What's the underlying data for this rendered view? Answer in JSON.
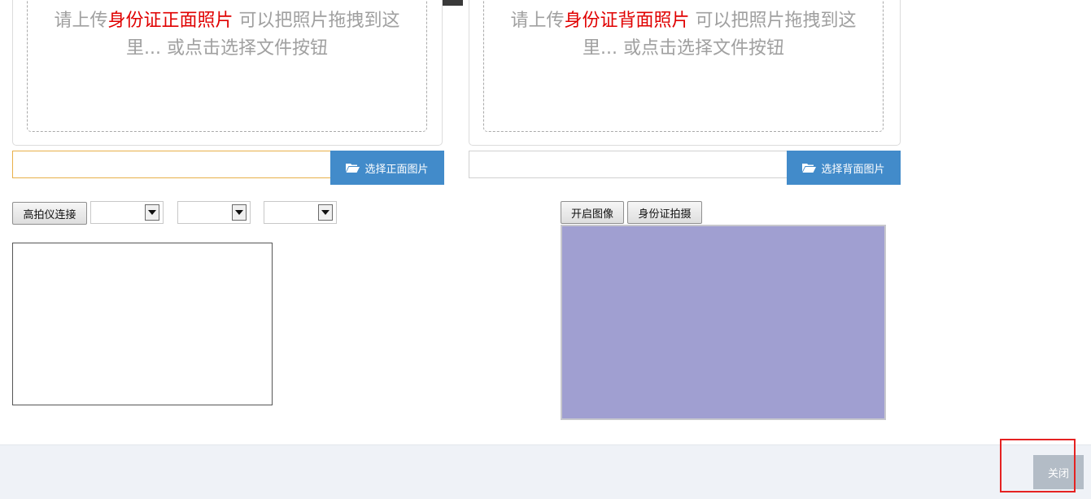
{
  "front_upload": {
    "drop_prefix": "请上传",
    "drop_highlight": "身份证正面照片",
    "drop_suffix": " 可以把照片拖拽到这里... 或点击选择文件按钮",
    "path_value": "",
    "button_label": "选择正面图片"
  },
  "back_upload": {
    "drop_prefix": "请上传",
    "drop_highlight": "身份证背面照片",
    "drop_suffix": " 可以把照片拖拽到这里... 或点击选择文件按钮",
    "path_value": "",
    "button_label": "选择背面图片"
  },
  "scanner": {
    "connect_label": "高拍仪连接",
    "select1_value": "",
    "select2_value": "",
    "select3_value": ""
  },
  "camera": {
    "open_label": "开启图像",
    "capture_label": "身份证拍摄"
  },
  "footer": {
    "close_label": "关闭"
  },
  "colors": {
    "accent_blue": "#428bca",
    "highlight_red": "#e00000",
    "camera_bg": "#a09fd1",
    "close_button": "#b3bcc6",
    "annotation_red": "#e52222"
  }
}
